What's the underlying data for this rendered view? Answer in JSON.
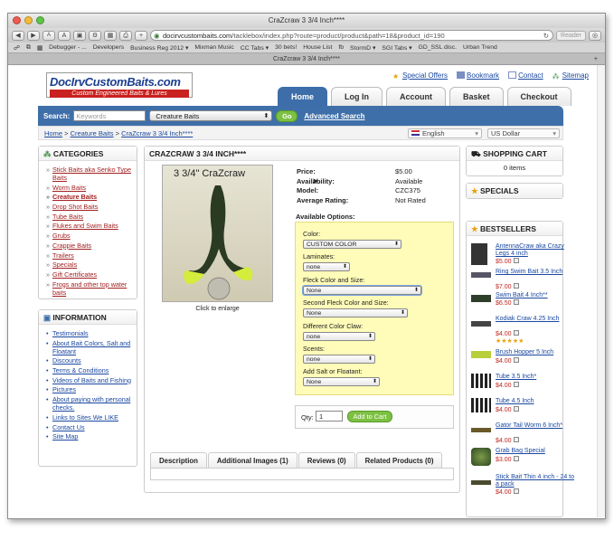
{
  "browser": {
    "window_title": "CraZcraw 3 3/4 Inch****",
    "url_host": "docirvcustombaits.com",
    "url_path": "/tacklebox/index.php?route=product/product&path=18&product_id=190",
    "reader_label": "Reader",
    "tab_title": "CraZcraw 3 3/4 Inch****",
    "toolbar_a_small": "A",
    "toolbar_a_large": "A",
    "toolbar_plus": "+",
    "bookmarks": [
      "Debugger - ...",
      "Developers",
      "Business Reg 2012 ▾",
      "Mixman Music",
      "CC Tabs ▾",
      "30 bets!",
      "House List",
      "fb",
      "StormD ▾",
      "SGI Tabs ▾",
      "GD_SSL disc.",
      "Urban Trend"
    ],
    "overflow": "»"
  },
  "logo": {
    "title": "DocIrvCustomBaits.com",
    "tagline": "Custom Engineered Baits & Lures"
  },
  "top_links": {
    "special_offers": "Special Offers",
    "bookmark": "Bookmark",
    "contact": "Contact",
    "sitemap": "Sitemap"
  },
  "nav_tabs": [
    "Home",
    "Log In",
    "Account",
    "Basket",
    "Checkout"
  ],
  "search": {
    "label": "Search:",
    "placeholder": "Keywords",
    "category": "Creature Baits",
    "go": "Go",
    "advanced": "Advanced Search"
  },
  "breadcrumb": {
    "home": "Home",
    "sep": ">",
    "category": "Creature Baits",
    "product": "CraZcraw 3 3/4 Inch****"
  },
  "language": "English",
  "currency": "US Dollar",
  "categories": {
    "title": "CATEGORIES",
    "items": [
      "Stick Baits aka Senko Type Baits",
      "Worm Baits",
      "Creature Baits",
      "Drop Shot Baits",
      "Tube Baits",
      "Flukes and Swim Baits",
      "Grubs",
      "Crappie Baits",
      "Trailers",
      "Specials",
      "Gift Certificates",
      "Frogs and other top water baits"
    ]
  },
  "information": {
    "title": "INFORMATION",
    "items": [
      "Testimonials",
      "About Bait Colors, Salt and Floatant",
      "Discounts",
      "Terms & Conditions",
      "Videos of Baits and Fishing",
      "Pictures",
      "About paying with personal checks.",
      "Links to Sites We LIKE",
      "Contact Us",
      "Site Map"
    ]
  },
  "product": {
    "heading": "CRAZCRAW 3 3/4 INCH****",
    "image_caption": "3 3/4\" CraZcraw",
    "click_to_enlarge": "Click to enlarge",
    "specs": [
      {
        "label": "Price:",
        "value": "$5.00"
      },
      {
        "label": "Availability:",
        "value": "Available"
      },
      {
        "label": "Model:",
        "value": "CZC375"
      },
      {
        "label": "Average Rating:",
        "value": "Not Rated"
      }
    ],
    "options_title": "Available Options:",
    "options": [
      {
        "label": "Color:",
        "value": "CUSTOM COLOR"
      },
      {
        "label": "Laminates:",
        "value": "none"
      },
      {
        "label": "Fleck Color and Size:",
        "value": "None"
      },
      {
        "label": "Second Fleck Color and Size:",
        "value": "None"
      },
      {
        "label": "Different Color Claw:",
        "value": "none"
      },
      {
        "label": "Scents:",
        "value": "none"
      },
      {
        "label": "Add Salt or Floatant:",
        "value": "None"
      }
    ],
    "qty_label": "Qty:",
    "qty_value": "1",
    "add_to_cart": "Add to Cart",
    "tabs": [
      "Description",
      "Additional Images (1)",
      "Reviews (0)",
      "Related Products (0)"
    ]
  },
  "cart": {
    "title": "SHOPPING CART",
    "items": "0 items"
  },
  "specials": {
    "title": "SPECIALS"
  },
  "bestsellers": {
    "title": "BESTSELLERS",
    "items": [
      {
        "name": "AntennaCraw aka Crazy Legs 4 inch",
        "price": "$5.00"
      },
      {
        "name": "Ring Swim Bait 3.5 Inch",
        "price": "$7.00"
      },
      {
        "name": "Swim Bait 4 Inch**",
        "price": "$6.50"
      },
      {
        "name": "Kodiak Craw 4.25 Inch",
        "price": "$4.00",
        "stars": "★★★★★"
      },
      {
        "name": "Brush Hopper 5 Inch",
        "price": "$4.00"
      },
      {
        "name": "Tube 3.5 Inch*",
        "price": "$4.00"
      },
      {
        "name": "Tube 4.5 Inch",
        "price": "$4.00"
      },
      {
        "name": "Gator Tail Worm 6 Inch*",
        "price": "$4.00"
      },
      {
        "name": "Grab Bag Special",
        "price": "$3.00"
      },
      {
        "name": "Stick Bait Thin 4 inch - 24 to a pack",
        "price": "$4.00"
      }
    ]
  },
  "colors": {
    "accent_blue": "#3f6fa9",
    "link_red": "#a32020",
    "price_red": "#c0261f",
    "go_green": "#7dc142",
    "options_bg": "#fffbb8"
  }
}
